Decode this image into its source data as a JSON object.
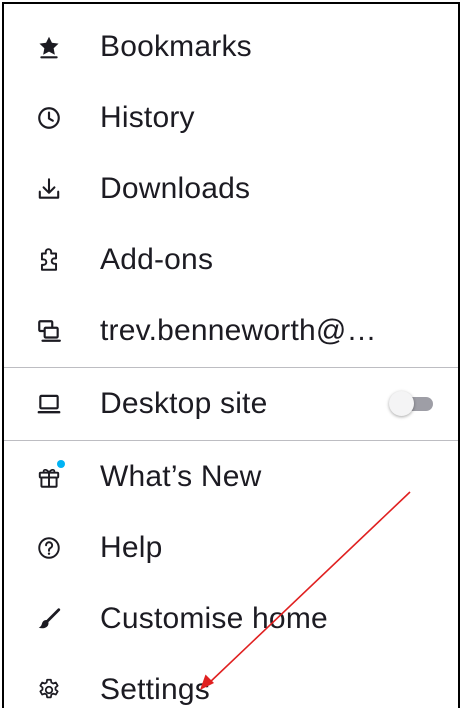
{
  "menu": {
    "items": [
      {
        "label": "Bookmarks",
        "icon": "star-icon"
      },
      {
        "label": "History",
        "icon": "clock-icon"
      },
      {
        "label": "Downloads",
        "icon": "download-icon"
      },
      {
        "label": "Add-ons",
        "icon": "puzzle-icon"
      },
      {
        "label": "trev.benneworth@…",
        "icon": "synced-devices-icon"
      }
    ],
    "desktop_site": {
      "label": "Desktop site",
      "icon": "laptop-icon",
      "toggle_on": false
    },
    "secondary_items": [
      {
        "label": "What’s New",
        "icon": "gift-icon",
        "has_notification_dot": true
      },
      {
        "label": "Help",
        "icon": "help-icon"
      },
      {
        "label": "Customise home",
        "icon": "brush-icon"
      },
      {
        "label": "Settings",
        "icon": "gear-icon"
      }
    ]
  },
  "colors": {
    "text": "#1c1b22",
    "divider": "#bdbdc2",
    "notification_dot": "#00b3f4",
    "toggle_off_track": "#9e9ea6",
    "annotation_arrow": "#e02020"
  },
  "annotation": {
    "type": "arrow",
    "points_to": "Settings"
  }
}
